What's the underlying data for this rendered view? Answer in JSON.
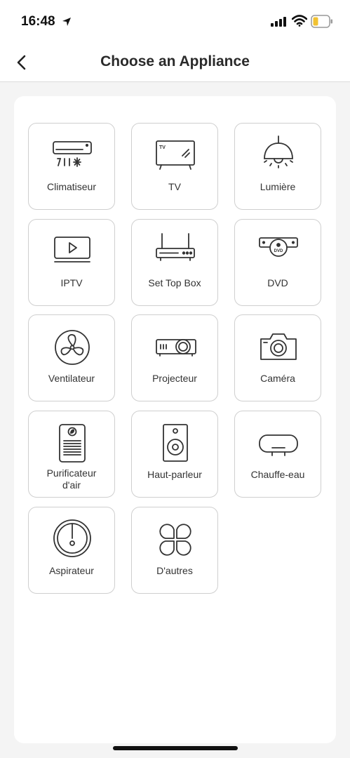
{
  "status_bar": {
    "time": "16:48"
  },
  "header": {
    "title": "Choose an Appliance"
  },
  "appliances": [
    {
      "label": "Climatiseur",
      "icon": "air-conditioner-icon"
    },
    {
      "label": "TV",
      "icon": "tv-icon"
    },
    {
      "label": "Lumière",
      "icon": "light-icon"
    },
    {
      "label": "IPTV",
      "icon": "iptv-icon"
    },
    {
      "label": "Set Top Box",
      "icon": "set-top-box-icon"
    },
    {
      "label": "DVD",
      "icon": "dvd-icon"
    },
    {
      "label": "Ventilateur",
      "icon": "fan-icon"
    },
    {
      "label": "Projecteur",
      "icon": "projector-icon"
    },
    {
      "label": "Caméra",
      "icon": "camera-icon"
    },
    {
      "label": "Purificateur d'air",
      "icon": "air-purifier-icon"
    },
    {
      "label": "Haut-parleur",
      "icon": "speaker-icon"
    },
    {
      "label": "Chauffe-eau",
      "icon": "water-heater-icon"
    },
    {
      "label": "Aspirateur",
      "icon": "robot-vacuum-icon"
    },
    {
      "label": "D'autres",
      "icon": "others-icon"
    }
  ],
  "icon_text": {
    "tv": "TV",
    "dvd": "DVD"
  },
  "colors": {
    "icon_stroke": "#333333",
    "tile_border": "#cfcfcf",
    "page_bg": "#f4f4f4"
  }
}
